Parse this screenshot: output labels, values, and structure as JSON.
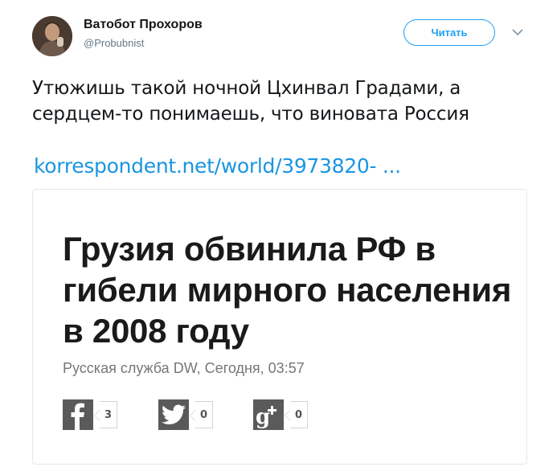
{
  "author": {
    "name": "Ватобот Прохоров",
    "handle": "@Probubnist"
  },
  "follow_button": {
    "label": "Читать"
  },
  "tweet": {
    "text": "Утюжишь такой ночной Цхинвал Градами, а сердцем-то понимаешь, что виновата Россия",
    "link": "korrespondent.net/world/3973820-  ..."
  },
  "card": {
    "headline": "Грузия обвинила РФ в гибели мирного населения в 2008 году",
    "byline": "Русская служба DW, Сегодня, 03:57",
    "shares": [
      {
        "icon": "facebook-icon",
        "count": "3"
      },
      {
        "icon": "twitter-icon",
        "count": "0"
      },
      {
        "icon": "google-plus-icon",
        "count": "0"
      }
    ]
  },
  "colors": {
    "accent": "#1da1f2",
    "link": "#1b95e0",
    "share_icon_bg": "#5a5a5a",
    "byline": "#777777"
  }
}
